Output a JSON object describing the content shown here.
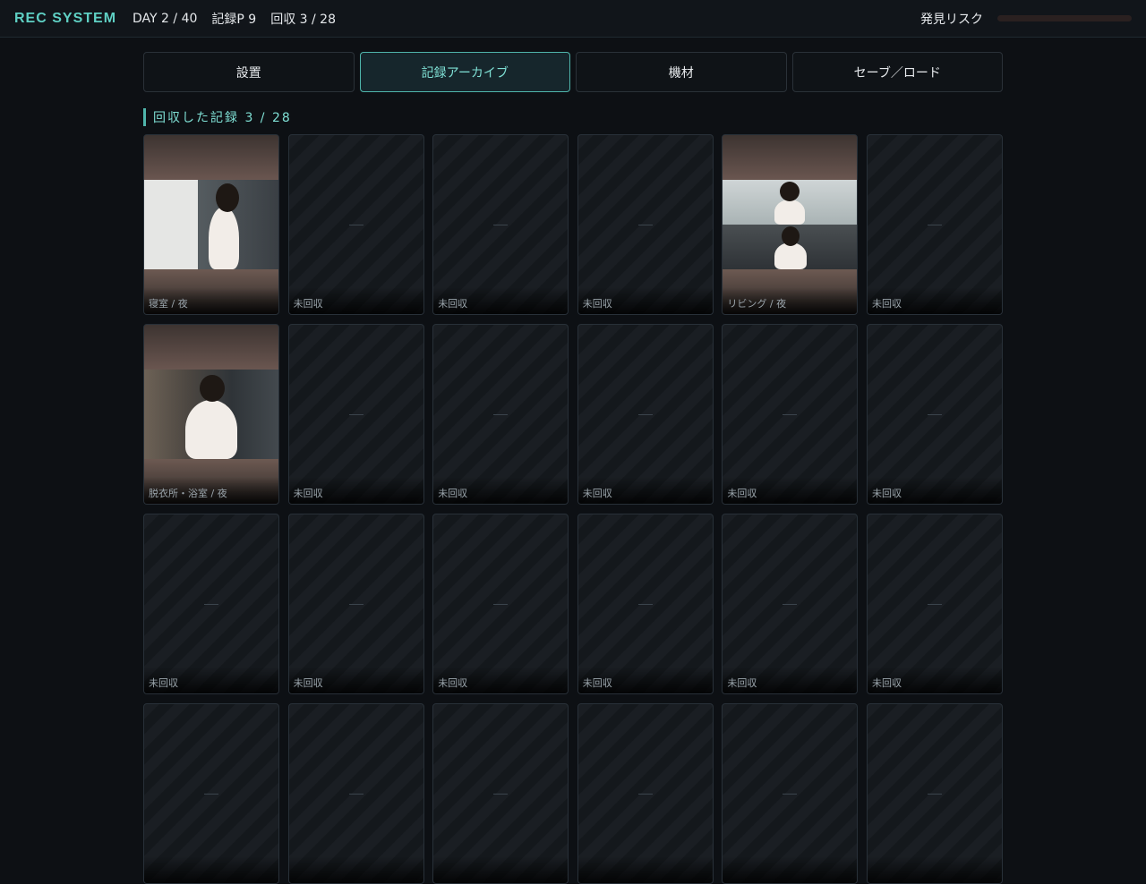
{
  "topbar": {
    "brand": "REC SYSTEM",
    "day": "DAY 2 / 40",
    "points": "記録P 9",
    "recovered": "回収 3 / 28",
    "risk_label": "発見リスク",
    "risk_level": 0
  },
  "tabs": [
    {
      "label": "設置",
      "active": false
    },
    {
      "label": "記録アーカイブ",
      "active": true
    },
    {
      "label": "機材",
      "active": false
    },
    {
      "label": "セーブ／ロード",
      "active": false
    }
  ],
  "section": {
    "title": "回収した記録 3 / 28"
  },
  "archive": {
    "cards": [
      {
        "caption": "寝室 / 夜",
        "recovered": true,
        "scene": "closet"
      },
      {
        "caption": "未回収",
        "recovered": false
      },
      {
        "caption": "未回収",
        "recovered": false
      },
      {
        "caption": "未回収",
        "recovered": false
      },
      {
        "caption": "リビング / 夜",
        "recovered": true,
        "scene": "living"
      },
      {
        "caption": "未回収",
        "recovered": false
      },
      {
        "caption": "脱衣所・浴室 / 夜",
        "recovered": true,
        "scene": "bath"
      },
      {
        "caption": "未回収",
        "recovered": false
      },
      {
        "caption": "未回収",
        "recovered": false
      },
      {
        "caption": "未回収",
        "recovered": false
      },
      {
        "caption": "未回収",
        "recovered": false
      },
      {
        "caption": "未回収",
        "recovered": false
      },
      {
        "caption": "未回収",
        "recovered": false
      },
      {
        "caption": "未回収",
        "recovered": false
      },
      {
        "caption": "未回収",
        "recovered": false
      },
      {
        "caption": "未回収",
        "recovered": false
      },
      {
        "caption": "未回収",
        "recovered": false
      },
      {
        "caption": "未回収",
        "recovered": false
      },
      {
        "caption": "",
        "recovered": false
      },
      {
        "caption": "",
        "recovered": false
      },
      {
        "caption": "",
        "recovered": false
      },
      {
        "caption": "",
        "recovered": false
      },
      {
        "caption": "",
        "recovered": false
      },
      {
        "caption": "",
        "recovered": false
      }
    ]
  },
  "colors": {
    "accent": "#5fd0c4",
    "background": "#0d1014",
    "risk": "#c94b4b"
  }
}
